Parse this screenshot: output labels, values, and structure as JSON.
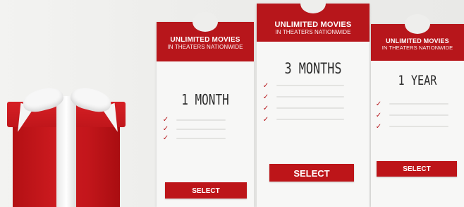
{
  "colors": {
    "accent": "#b7161b",
    "button": "#bd1519",
    "card_bg": "#f7f7f6",
    "page_bg": "#eeeeec"
  },
  "gift": {
    "icon": "gift-box-icon"
  },
  "plans": [
    {
      "title": "UNLIMITED MOVIES",
      "subtitle": "IN THEATERS NATIONWIDE",
      "plan": "1 MONTH",
      "features": [
        "",
        "",
        ""
      ],
      "button_label": "SELECT"
    },
    {
      "title": "UNLIMITED MOVIES",
      "subtitle": "IN THEATERS NATIONWIDE",
      "plan": "3 MONTHS",
      "features": [
        "",
        "",
        "",
        ""
      ],
      "button_label": "SELECT"
    },
    {
      "title": "UNLIMITED MOVIES",
      "subtitle": "IN THEATERS NATIONWIDE",
      "plan": "1 YEAR",
      "features": [
        "",
        "",
        ""
      ],
      "button_label": "SELECT"
    }
  ],
  "check_icon": "checkmark-icon"
}
